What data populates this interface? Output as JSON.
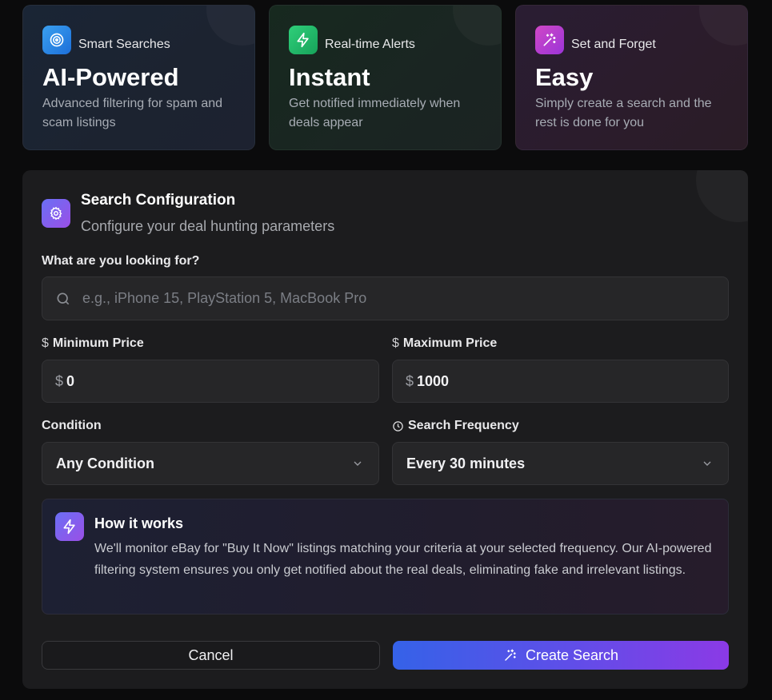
{
  "features": [
    {
      "tag": "Smart Searches",
      "title": "AI-Powered",
      "desc": "Advanced filtering for spam and scam listings",
      "icon": "target-icon"
    },
    {
      "tag": "Real-time Alerts",
      "title": "Instant",
      "desc": "Get notified immediately when deals appear",
      "icon": "bolt-icon"
    },
    {
      "tag": "Set and Forget",
      "title": "Easy",
      "desc": "Simply create a search and the rest is done for you",
      "icon": "sparkles-icon"
    }
  ],
  "config": {
    "title": "Search Configuration",
    "subtitle": "Configure your deal hunting parameters",
    "query_label": "What are you looking for?",
    "query_placeholder": "e.g., iPhone 15, PlayStation 5, MacBook Pro",
    "min_label": "Minimum Price",
    "min_value": "0",
    "max_label": "Maximum Price",
    "max_value": "1000",
    "currency": "$",
    "condition_label": "Condition",
    "condition_value": "Any Condition",
    "frequency_label": "Search Frequency",
    "frequency_value": "Every 30 minutes"
  },
  "info": {
    "title": "How it works",
    "text": "We'll monitor eBay for \"Buy It Now\" listings matching your criteria at your selected frequency. Our AI-powered filtering system ensures you only get notified about the real deals, eliminating fake and irrelevant listings."
  },
  "actions": {
    "cancel": "Cancel",
    "create": "Create Search"
  }
}
